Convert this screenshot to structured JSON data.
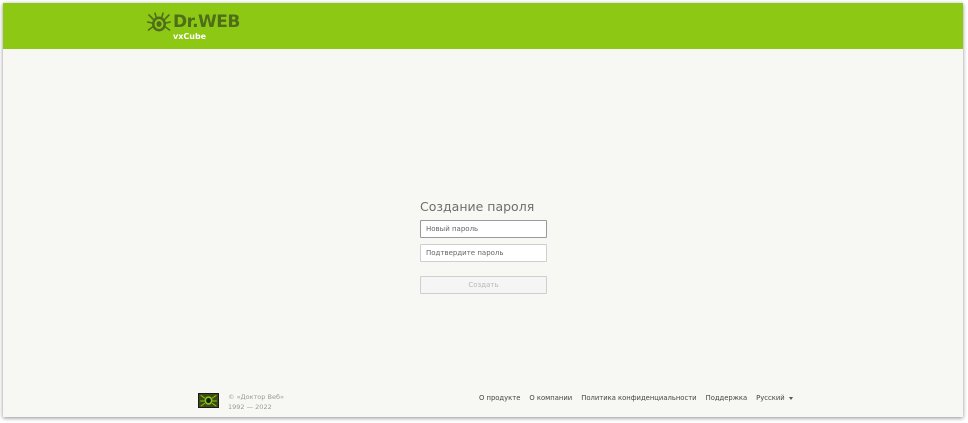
{
  "header": {
    "logo_title": "Dr.WEB",
    "logo_subtitle": "vxCube",
    "background": "#8dc814"
  },
  "form": {
    "title": "Создание пароля",
    "new_password_placeholder": "Новый пароль",
    "confirm_password_placeholder": "Подтвердите пароль",
    "submit_label": "Создать"
  },
  "footer": {
    "copyright_line1": "© «Доктор Веб»",
    "copyright_line2": "1992 — 2022",
    "links": {
      "about_product": "О продукте",
      "about_company": "О компании",
      "privacy_policy": "Политика конфиденциальности",
      "support": "Поддержка"
    },
    "language": "Русский"
  },
  "icons": {
    "header_logo": "drweb-spider-icon",
    "footer_logo": "drweb-spider-badge-icon",
    "language_caret": "caret-down-icon"
  }
}
